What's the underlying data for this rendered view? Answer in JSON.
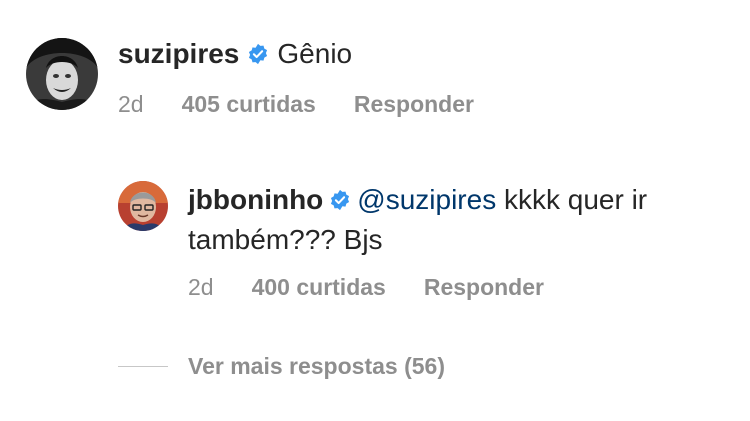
{
  "comment": {
    "username": "suzipires",
    "verified_icon": "verified-badge-icon",
    "text": "Gênio",
    "time": "2d",
    "likes": "405 curtidas",
    "reply_label": "Responder"
  },
  "reply": {
    "username": "jbboninho",
    "verified_icon": "verified-badge-icon",
    "mention": "@suzipires",
    "text": " kkkk quer ir também??? Bjs",
    "time": "2d",
    "likes": "400 curtidas",
    "reply_label": "Responder"
  },
  "view_more": "Ver mais respostas (56)",
  "colors": {
    "text": "#262626",
    "muted": "#8e8e8e",
    "mention": "#00376b",
    "verified": "#3897f0"
  }
}
